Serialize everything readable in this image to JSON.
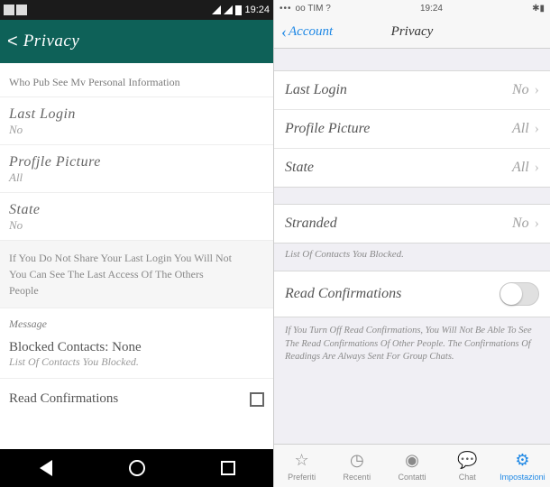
{
  "left": {
    "statusbar": {
      "time": "19:24"
    },
    "header": {
      "title": "Privacy"
    },
    "section_header": "Who Pub See Mv Personal Information",
    "items": [
      {
        "title": "Last Login",
        "value": "No"
      },
      {
        "title": "Profjle Picture",
        "value": "All"
      },
      {
        "title": "State",
        "value": "No"
      }
    ],
    "note_lines": [
      "If You Do Not Share Your Last Login You Will Not",
      "You Can See The Last Access Of The Others",
      "People"
    ],
    "message_header": "Message",
    "blocked": {
      "title": "Blocked Contacts: None",
      "sub": "List Of Contacts You Blocked."
    },
    "read_conf": "Read Confirmations"
  },
  "right": {
    "statusbar": {
      "carrier": "oo TIM ?",
      "time": "19:24"
    },
    "header": {
      "back": "Account",
      "title": "Privacy"
    },
    "group1": [
      {
        "label": "Last Login",
        "value": "No"
      },
      {
        "label": "Profile Picture",
        "value": "All"
      },
      {
        "label": "State",
        "value": "All"
      }
    ],
    "group2": [
      {
        "label": "Stranded",
        "value": "No"
      }
    ],
    "group2_note": "List Of Contacts You Blocked.",
    "group3_label": "Read Confirmations",
    "group3_note": "If You Turn Off Read Confirmations, You Will Not Be Able To See The Read Confirmations Of Other People. The Confirmations Of Readings Are Always Sent For Group Chats.",
    "tabs": [
      {
        "label": "Preferiti"
      },
      {
        "label": "Recenti"
      },
      {
        "label": "Contatti"
      },
      {
        "label": "Chat"
      },
      {
        "label": "Impostazioni"
      }
    ]
  }
}
